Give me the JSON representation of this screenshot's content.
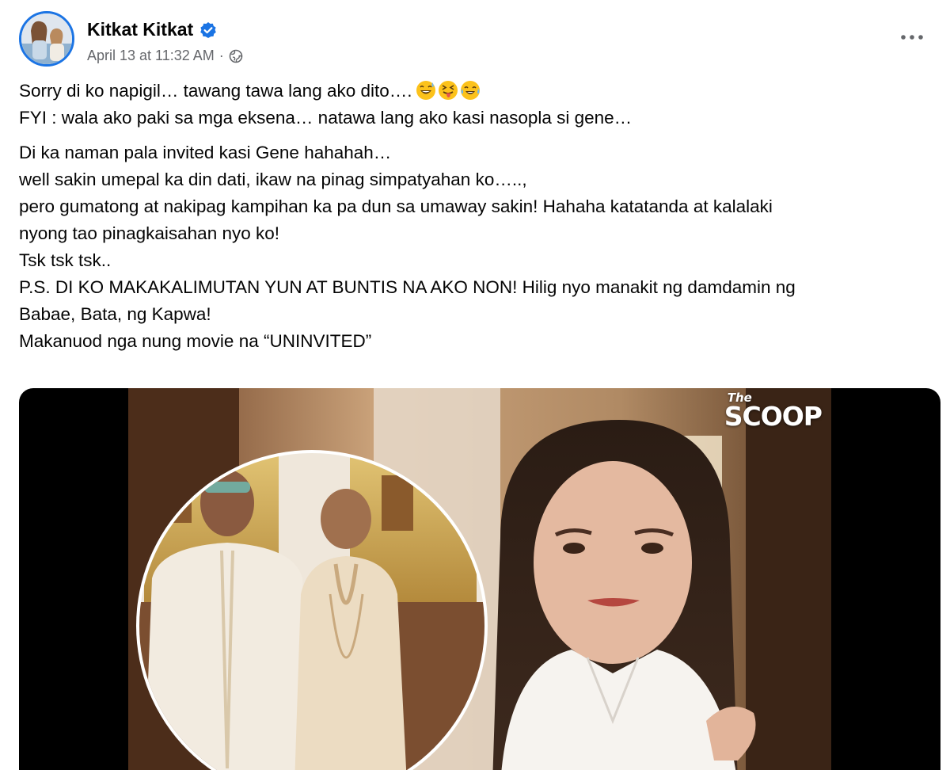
{
  "post": {
    "author": "Kitkat Kitkat",
    "timestamp": "April 13 at 11:32 AM",
    "separator": "·",
    "verified_icon": "verified-badge-icon",
    "audience_icon": "globe-icon",
    "more_icon": "more-options-icon"
  },
  "content": {
    "para1": [
      "Sorry di ko napigil… tawang tawa lang ako dito….",
      "FYI : wala ako paki sa mga eksena… natawa lang ako kasi nasopla si gene…"
    ],
    "para2": [
      "Di ka naman pala invited kasi Gene hahahah…",
      "well sakin umepal ka din dati, ikaw na pinag simpatyahan ko…..,",
      "pero gumatong at nakipag kampihan ka pa dun sa umaway sakin! Hahaha katatanda at kalalaki",
      "nyong tao pinagkaisahan nyo ko!",
      "Tsk tsk tsk..",
      "P.S. DI KO MAKAKALIMUTAN YUN AT BUNTIS NA AKO NON! Hilig nyo manakit ng damdamin ng",
      "Babae, Bata, ng Kapwa!",
      "Makanuod nga nung movie na “UNINVITED”"
    ],
    "emojis": [
      "grinning-sweat-emoji",
      "squinting-tongue-emoji",
      "tears-of-joy-emoji"
    ]
  },
  "media": {
    "logo_small": "The",
    "logo_big": "SCOOP"
  },
  "colors": {
    "accent": "#1b74e4",
    "meta_text": "#65676b",
    "text": "#050505"
  }
}
